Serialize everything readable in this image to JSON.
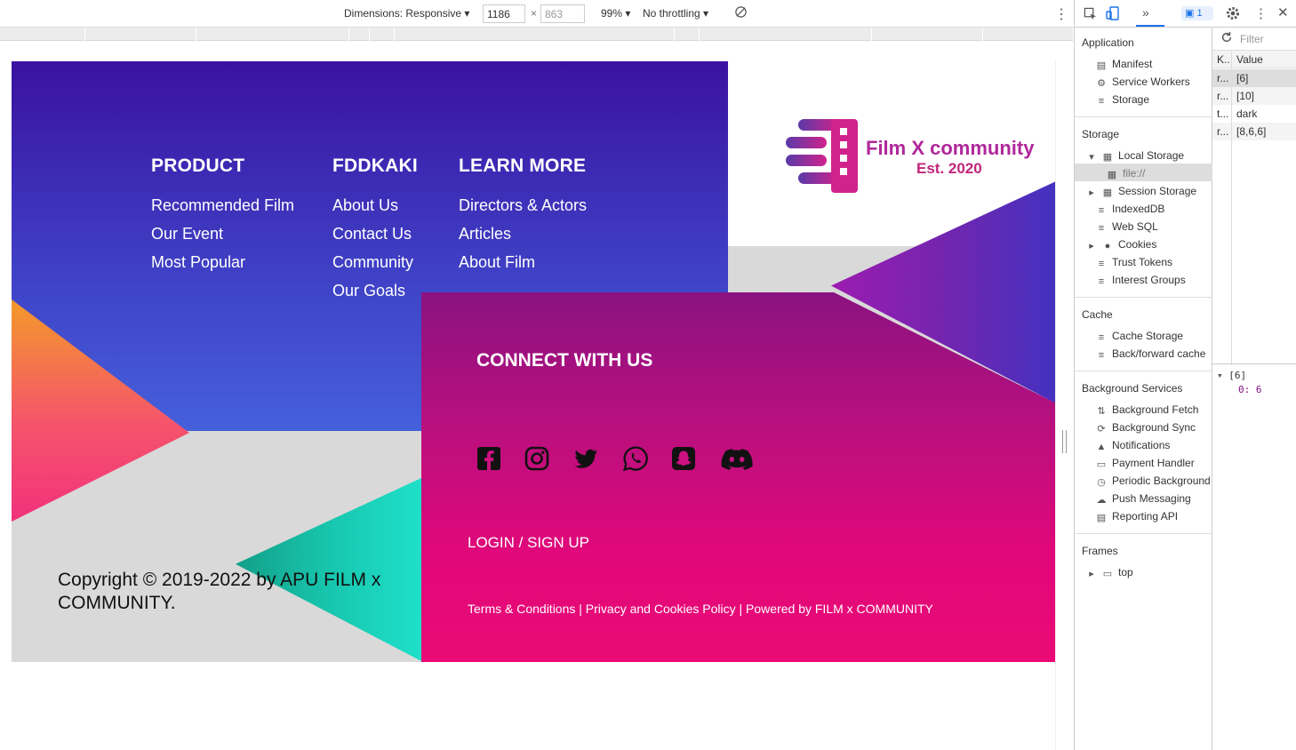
{
  "device_toolbar": {
    "dimensions_label": "Dimensions: Responsive",
    "width": "1186",
    "times": "×",
    "height": "863",
    "zoom": "99%",
    "throttling": "No throttling"
  },
  "footer": {
    "columns": [
      {
        "title": "PRODUCT",
        "links": [
          "Recommended Film",
          "Our Event",
          "Most Popular"
        ]
      },
      {
        "title": "FDDKAKI",
        "links": [
          "About Us",
          "Contact Us",
          "Community",
          "Our Goals"
        ]
      },
      {
        "title": "LEARN MORE",
        "links": [
          "Directors & Actors",
          "Articles",
          "About Film"
        ]
      }
    ],
    "logo": {
      "title": "Film X community",
      "subtitle": "Est. 2020"
    },
    "connect_heading": "CONNECT WITH US",
    "social_icons": [
      "facebook-icon",
      "instagram-icon",
      "twitter-icon",
      "whatsapp-icon",
      "snapchat-icon",
      "discord-icon"
    ],
    "login_label": "LOGIN / SIGN UP",
    "legal_text": "Terms & Conditions | Privacy and Cookies Policy | Powered by FILM x COMMUNITY",
    "copyright": "Copyright © 2019-2022 by APU FILM x COMMUNITY."
  },
  "devtools": {
    "issues_count": "1",
    "filter_placeholder": "Filter",
    "sections": {
      "application": "Application",
      "storage": "Storage",
      "cache": "Cache",
      "background_services": "Background Services",
      "frames": "Frames"
    },
    "application_items": [
      "Manifest",
      "Service Workers",
      "Storage"
    ],
    "storage_items": [
      "Local Storage",
      "file://",
      "Session Storage",
      "IndexedDB",
      "Web SQL",
      "Cookies",
      "Trust Tokens",
      "Interest Groups"
    ],
    "cache_items": [
      "Cache Storage",
      "Back/forward cache"
    ],
    "background_items": [
      "Background Fetch",
      "Background Sync",
      "Notifications",
      "Payment Handler",
      "Periodic Background",
      "Push Messaging",
      "Reporting API"
    ],
    "frames_items": [
      "top"
    ],
    "table": {
      "headers": [
        "K..",
        "Value"
      ],
      "rows": [
        {
          "k": "r...",
          "v": "[6]"
        },
        {
          "k": "r...",
          "v": "[10]"
        },
        {
          "k": "t...",
          "v": "dark"
        },
        {
          "k": "r...",
          "v": "[8,6,6]"
        }
      ]
    },
    "preview": {
      "head": "[6]",
      "line": "0: 6"
    }
  }
}
